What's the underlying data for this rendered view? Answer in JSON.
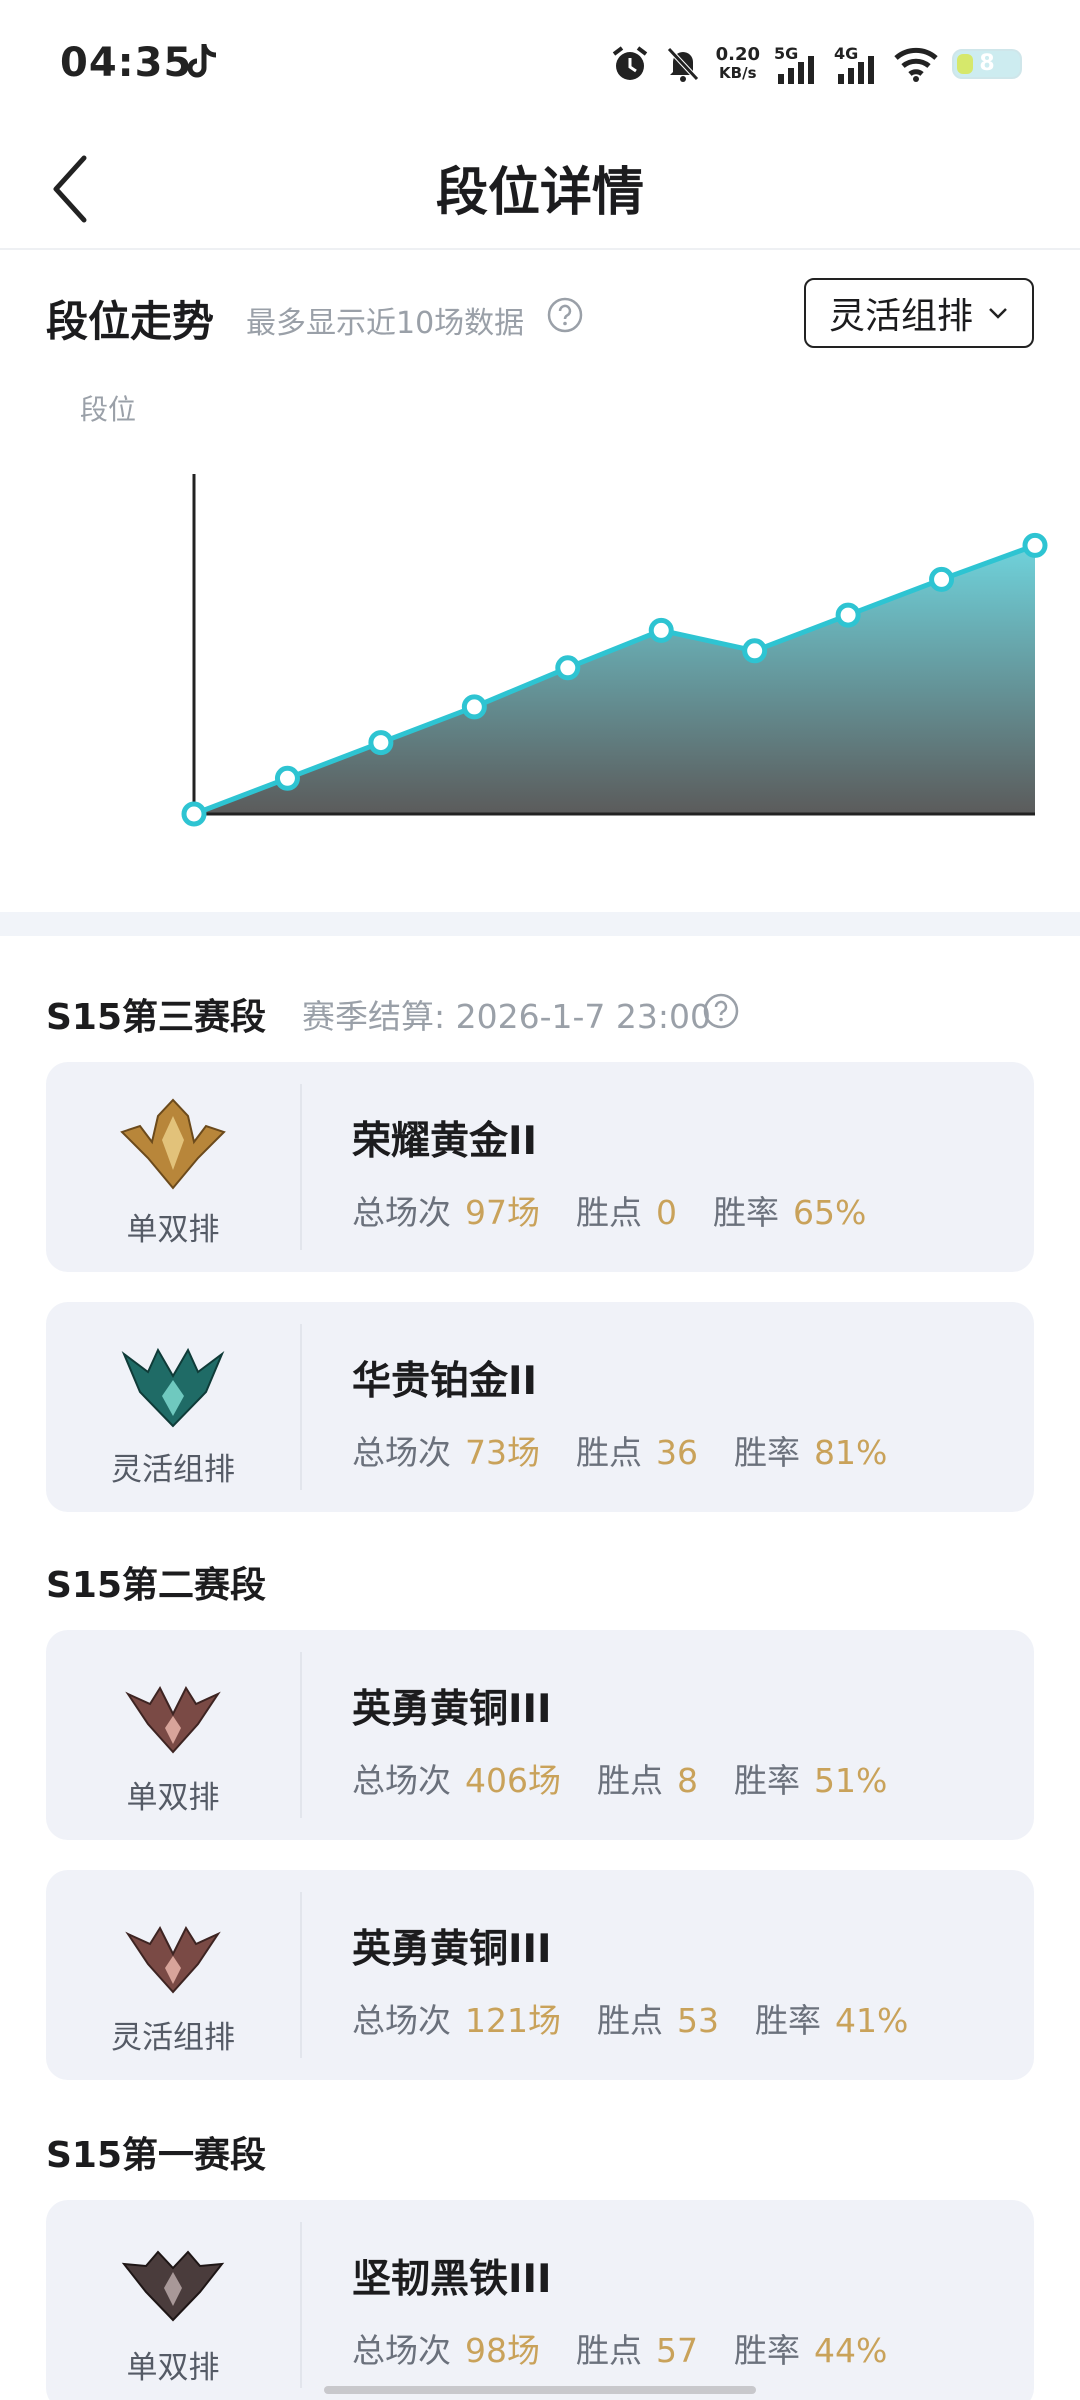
{
  "status_bar": {
    "time": "04:35",
    "net_speed_value": "0.20",
    "net_speed_unit": "KB/s",
    "signal_1": "5G",
    "signal_2": "4G",
    "battery": "8"
  },
  "header": {
    "title": "段位详情"
  },
  "trend": {
    "title": "段位走势",
    "hint": "最多显示近10场数据",
    "dropdown": "灵活组排",
    "y_axis_label": "段位"
  },
  "chart_data": {
    "type": "area",
    "title": "段位走势",
    "ylabel": "段位",
    "x": [
      1,
      2,
      3,
      4,
      5,
      6,
      7,
      8,
      9,
      10
    ],
    "values": [
      0,
      10.5,
      21,
      31.5,
      43,
      54,
      48,
      58.5,
      69,
      79
    ],
    "ylim": [
      0,
      100
    ],
    "grid": false,
    "colors": {
      "line": "#2ec4d2",
      "fill_top": "#6fd3dc",
      "fill_bottom": "#5b5b5b"
    }
  },
  "seasons": [
    {
      "title": "S15第三赛段",
      "subtitle": "赛季结算: 2026-1-7 23:00",
      "cards": [
        {
          "queue": "单双排",
          "rank": "荣耀黄金II",
          "emblem": "gold-emblem",
          "games_label": "总场次",
          "games": "97场",
          "lp_label": "胜点",
          "lp": "0",
          "wr_label": "胜率",
          "wr": "65%"
        },
        {
          "queue": "灵活组排",
          "rank": "华贵铂金II",
          "emblem": "platinum-emblem",
          "games_label": "总场次",
          "games": "73场",
          "lp_label": "胜点",
          "lp": "36",
          "wr_label": "胜率",
          "wr": "81%"
        }
      ]
    },
    {
      "title": "S15第二赛段",
      "cards": [
        {
          "queue": "单双排",
          "rank": "英勇黄铜III",
          "emblem": "bronze-emblem",
          "games_label": "总场次",
          "games": "406场",
          "lp_label": "胜点",
          "lp": "8",
          "wr_label": "胜率",
          "wr": "51%"
        },
        {
          "queue": "灵活组排",
          "rank": "英勇黄铜III",
          "emblem": "bronze-emblem",
          "games_label": "总场次",
          "games": "121场",
          "lp_label": "胜点",
          "lp": "53",
          "wr_label": "胜率",
          "wr": "41%"
        }
      ]
    },
    {
      "title": "S15第一赛段",
      "cards": [
        {
          "queue": "单双排",
          "rank": "坚韧黑铁III",
          "emblem": "iron-emblem",
          "games_label": "总场次",
          "games": "98场",
          "lp_label": "胜点",
          "lp": "57",
          "wr_label": "胜率",
          "wr": "44%"
        }
      ]
    }
  ],
  "colors": {
    "accent": "#2ec4d2",
    "stat_value": "#c9a25a",
    "card_bg": "#f0f2f8",
    "gold": "#b8863a",
    "platinum": "#1f6b66",
    "bronze": "#7a4a45",
    "iron": "#4a3c3c"
  }
}
